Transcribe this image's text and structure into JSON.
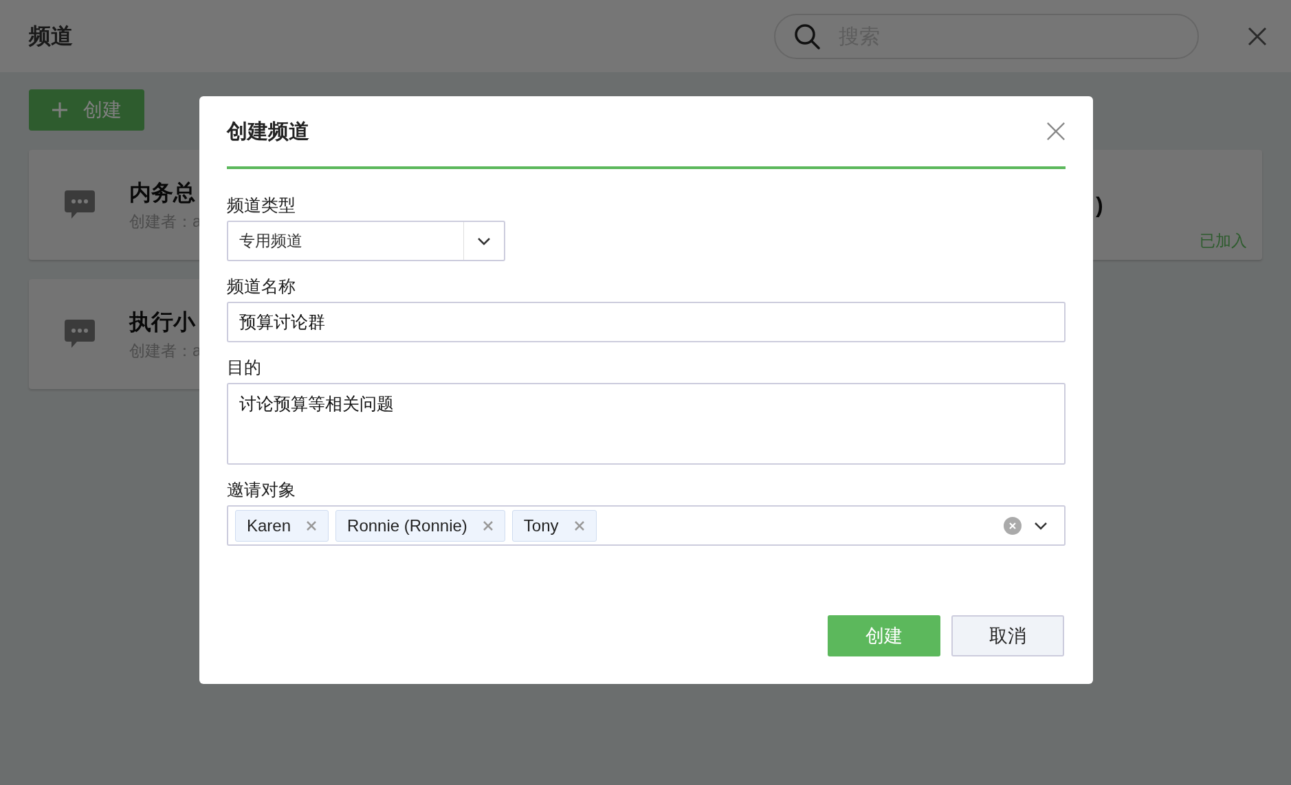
{
  "page": {
    "title": "频道",
    "search": {
      "placeholder": "搜索"
    },
    "create_button": "创建",
    "channels": [
      {
        "title": "内务总",
        "creator": "创建者：a"
      },
      {
        "title": ")",
        "status": "已加入"
      },
      {
        "title": "执行小",
        "creator": "创建者：a"
      }
    ]
  },
  "dialog": {
    "title": "创建频道",
    "fields": [
      {
        "kind": "select",
        "label": "频道类型",
        "value": "专用频道"
      },
      {
        "kind": "text",
        "label": "频道名称",
        "value": "预算讨论群"
      },
      {
        "kind": "textarea",
        "label": "目的",
        "value": "讨论预算等相关问题"
      },
      {
        "kind": "tags",
        "label": "邀请对象",
        "tags": [
          "Karen",
          "Ronnie (Ronnie)",
          "Tony"
        ]
      }
    ],
    "buttons": [
      {
        "kind": "primary",
        "label": "创建"
      },
      {
        "kind": "secondary",
        "label": "取消"
      }
    ]
  }
}
